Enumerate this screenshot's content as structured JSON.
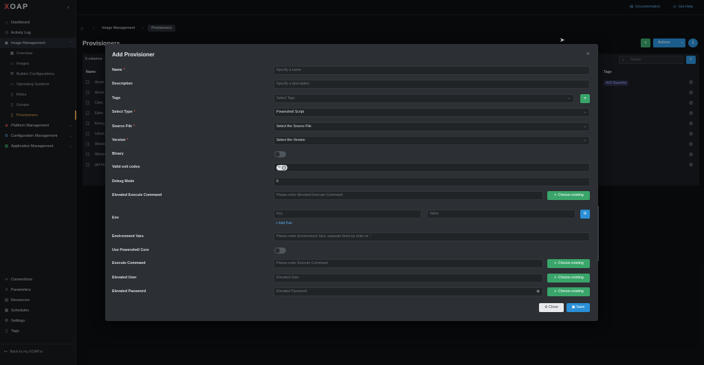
{
  "app": {
    "logo_prefix": "X",
    "logo_rest": "OAP"
  },
  "sidebar": {
    "items": [
      {
        "label": "Dashboard",
        "icon": "home-icon"
      },
      {
        "label": "Activity Log",
        "icon": "clock-icon"
      },
      {
        "label": "Image Management",
        "icon": "image-icon"
      }
    ],
    "sub_items": [
      {
        "label": "Overview"
      },
      {
        "label": "Images"
      },
      {
        "label": "Builder Configurations"
      },
      {
        "label": "Operating Systems"
      },
      {
        "label": "Roles"
      },
      {
        "label": "Groups"
      },
      {
        "label": "Provisioners"
      }
    ],
    "more_items": [
      {
        "label": "Platform Management"
      },
      {
        "label": "Configuration Management"
      },
      {
        "label": "Application Management"
      }
    ],
    "bottom_items": [
      {
        "label": "Connections"
      },
      {
        "label": "Parameters"
      },
      {
        "label": "Resources"
      },
      {
        "label": "Schedules"
      },
      {
        "label": "Settings"
      },
      {
        "label": "Tags"
      }
    ],
    "back_link": "Back to my.XOAP.io"
  },
  "topbar": {
    "documentation": "Documentation",
    "get_help": "Get Help"
  },
  "breadcrumb": {
    "parent": "Image Management",
    "current": "Provisioners"
  },
  "background": {
    "page_title": "Provisioners",
    "columns_button": "5 columns",
    "column_name": "Name",
    "column_tags": "Tags",
    "search_placeholder": "Search",
    "actions_label": "Actions",
    "rows": [
      "Azure",
      "Azure",
      "Citrix",
      "Ephe",
      "Energ",
      "Ubunt",
      "Windo",
      "Windo",
      "get-ho"
    ],
    "tag_badge": "AVD Baseline"
  },
  "modal": {
    "title": "Add Provisioner",
    "fields": {
      "name": {
        "label": "Name",
        "placeholder": "Specify a name"
      },
      "description": {
        "label": "Description",
        "placeholder": "Specify a description"
      },
      "tags": {
        "label": "Tags",
        "placeholder": "Select Tags"
      },
      "select_type": {
        "label": "Select Type",
        "value": "Powershell Script"
      },
      "source_file": {
        "label": "Source File",
        "value": "Select the Source File"
      },
      "version": {
        "label": "Version",
        "value": "Select the Version"
      },
      "binary": {
        "label": "Binary"
      },
      "valid_exit_codes": {
        "label": "Valid exit codes",
        "chip": "0"
      },
      "debug_mode": {
        "label": "Debug Mode",
        "value": "0"
      },
      "elevated_execute_command": {
        "label": "Elevated Execute Command",
        "placeholder": "Please enter Elevated Execute Command",
        "button": "Choose existing"
      },
      "env": {
        "label": "Env",
        "key_placeholder": "Key",
        "value_placeholder": "Value",
        "add_pair": "+ Add Pair"
      },
      "environment_vars": {
        "label": "Environment Vars",
        "placeholder": "Please enter Environment Vars, separate them by enter or ','"
      },
      "use_powershell_core": {
        "label": "Use Powershell Core"
      },
      "execute_command": {
        "label": "Execute Command",
        "placeholder": "Please enter Execute Command",
        "button": "Choose existing"
      },
      "elevated_user": {
        "label": "Elevated User",
        "placeholder": "Elevated User",
        "button": "Choose existing"
      },
      "elevated_password": {
        "label": "Elevated Password",
        "placeholder": "Elevated Password",
        "button": "Choose existing"
      }
    },
    "footer": {
      "close": "Close",
      "save": "Save"
    }
  },
  "colors": {
    "accent_blue": "#2a8fd6",
    "accent_green": "#3aa56a",
    "active_orange": "#e6a447",
    "required_red": "#e25555"
  }
}
